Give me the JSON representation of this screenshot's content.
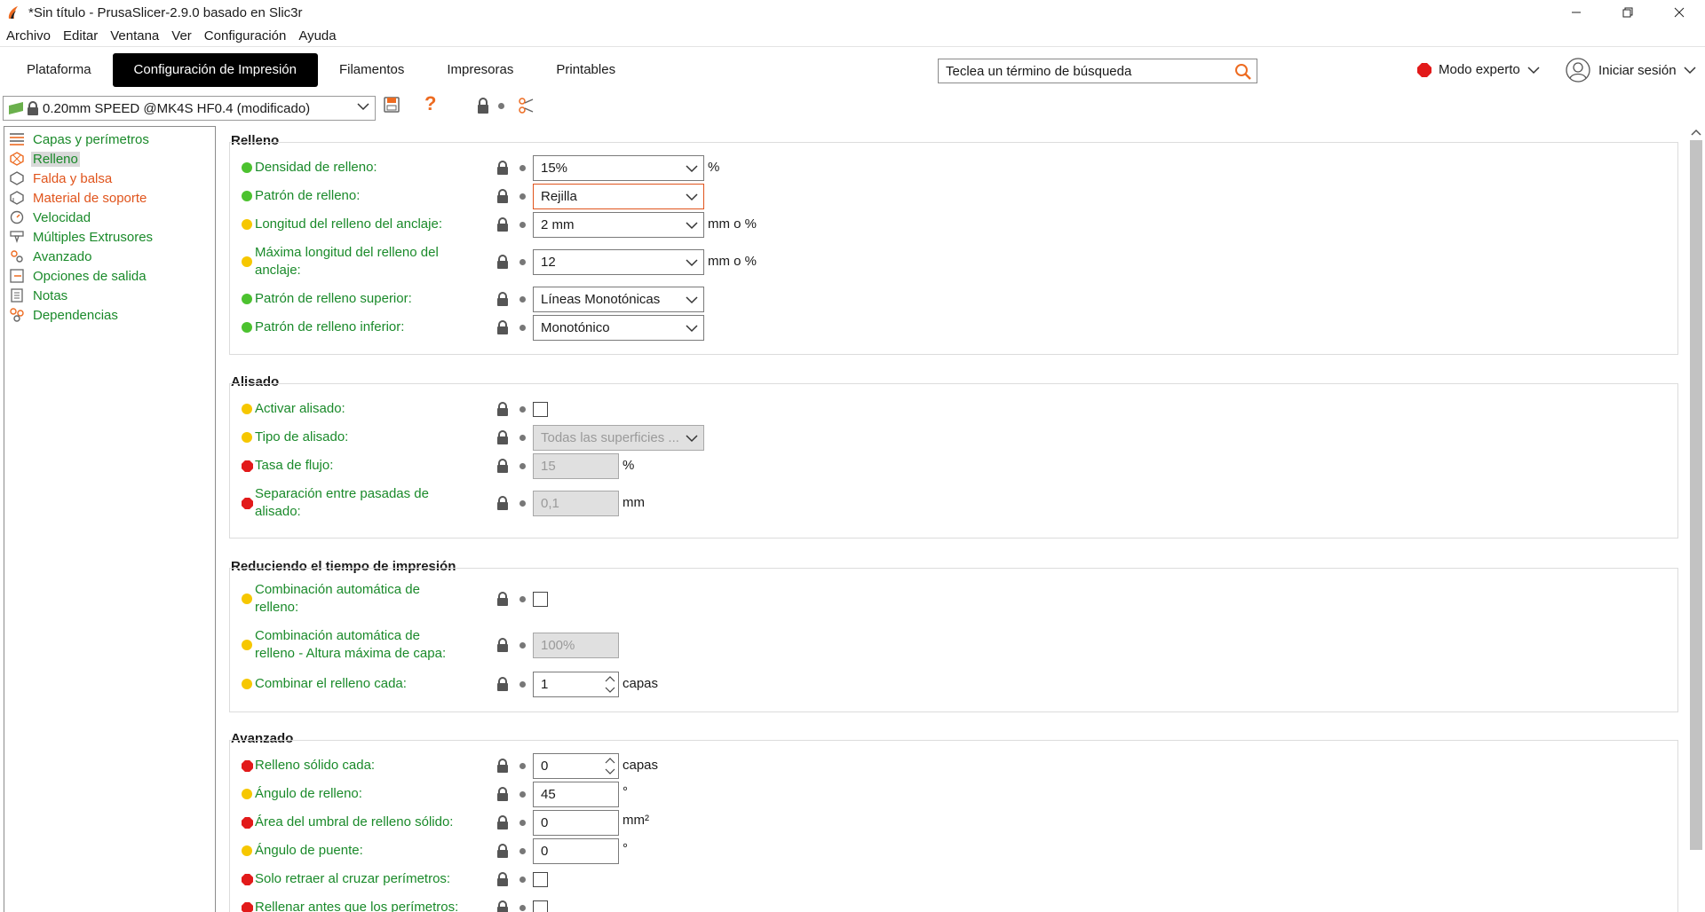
{
  "window": {
    "title": "*Sin título - PrusaSlicer-2.9.0 basado en Slic3r",
    "minimize_icon": "minimize-icon",
    "maximize_icon": "restore-icon",
    "close_icon": "close-icon"
  },
  "menu": [
    "Archivo",
    "Editar",
    "Ventana",
    "Ver",
    "Configuración",
    "Ayuda"
  ],
  "tabs": [
    {
      "label": "Plataforma",
      "active": false
    },
    {
      "label": "Configuración de Impresión",
      "active": true
    },
    {
      "label": "Filamentos",
      "active": false
    },
    {
      "label": "Impresoras",
      "active": false
    },
    {
      "label": "Printables",
      "active": false
    }
  ],
  "search": {
    "placeholder": "Teclea un término de búsqueda"
  },
  "mode": {
    "label": "Modo experto",
    "color": "#e21a1a"
  },
  "login": {
    "label": "Iniciar sesión"
  },
  "preset": {
    "value": "0.20mm SPEED @MK4S HF0.4 (modificado)"
  },
  "help_glyph": "?",
  "nav": [
    {
      "label": "Capas y perímetros",
      "color": "green",
      "icon": "layers-icon",
      "selected": false
    },
    {
      "label": "Relleno",
      "color": "green",
      "icon": "infill-icon",
      "selected": true
    },
    {
      "label": "Falda y balsa",
      "color": "orange",
      "icon": "skirt-icon",
      "selected": false
    },
    {
      "label": "Material de soporte",
      "color": "orange",
      "icon": "support-icon",
      "selected": false
    },
    {
      "label": "Velocidad",
      "color": "green",
      "icon": "speed-icon",
      "selected": false
    },
    {
      "label": "Múltiples Extrusores",
      "color": "green",
      "icon": "extruders-icon",
      "selected": false
    },
    {
      "label": "Avanzado",
      "color": "green",
      "icon": "advanced-icon",
      "selected": false
    },
    {
      "label": "Opciones de salida",
      "color": "green",
      "icon": "output-icon",
      "selected": false
    },
    {
      "label": "Notas",
      "color": "green",
      "icon": "notes-icon",
      "selected": false
    },
    {
      "label": "Dependencias",
      "color": "green",
      "icon": "dependencies-icon",
      "selected": false
    }
  ],
  "groups": {
    "relleno": {
      "title": "Relleno",
      "rows": [
        {
          "label": "Densidad de relleno:",
          "status": "g",
          "value": "15%",
          "unit": "%"
        },
        {
          "label": "Patrón de relleno:",
          "status": "g",
          "value": "Rejilla",
          "unit": ""
        },
        {
          "label": "Longitud del relleno del anclaje:",
          "status": "y",
          "value": "2 mm",
          "unit": "mm o %"
        },
        {
          "label_1": "Máxima longitud del relleno del",
          "label_2": "anclaje:",
          "status": "y",
          "value": "12",
          "unit": "mm o %"
        },
        {
          "label": "Patrón de relleno superior:",
          "status": "g",
          "value": "Líneas Monotónicas",
          "unit": ""
        },
        {
          "label": "Patrón de relleno inferior:",
          "status": "g",
          "value": "Monotónico",
          "unit": ""
        }
      ]
    },
    "alisado": {
      "title": "Alisado",
      "rows": [
        {
          "label": "Activar alisado:",
          "status": "y",
          "checked": false
        },
        {
          "label": "Tipo de alisado:",
          "status": "y",
          "value": "Todas las superficies ...",
          "disabled": true
        },
        {
          "label": "Tasa de flujo:",
          "status": "r",
          "value": "15",
          "unit": "%",
          "disabled": true
        },
        {
          "label_1": "Separación entre pasadas de",
          "label_2": "alisado:",
          "status": "r",
          "value": "0,1",
          "unit": "mm",
          "disabled": true
        }
      ]
    },
    "reduciendo": {
      "title": "Reduciendo el tiempo de impresión",
      "rows": [
        {
          "label_1": "Combinación automática de",
          "label_2": "relleno:",
          "status": "y",
          "checked": false
        },
        {
          "label_1": "Combinación automática de",
          "label_2": "relleno - Altura máxima de capa:",
          "status": "y",
          "value": "100%",
          "disabled": true
        },
        {
          "label": "Combinar el relleno cada:",
          "status": "y",
          "value": "1",
          "unit": "capas"
        }
      ]
    },
    "avanzado": {
      "title": "Avanzado",
      "rows": [
        {
          "label": "Relleno sólido cada:",
          "status": "r",
          "value": "0",
          "unit": "capas"
        },
        {
          "label": "Ángulo de relleno:",
          "status": "y",
          "value": "45",
          "unit": "°"
        },
        {
          "label": "Área del umbral de relleno sólido:",
          "status": "r",
          "value": "0",
          "unit": "mm²"
        },
        {
          "label": "Ángulo de puente:",
          "status": "y",
          "value": "0",
          "unit": "°"
        },
        {
          "label": "Solo retraer al cruzar perímetros:",
          "status": "r",
          "checked": false
        },
        {
          "label": "Rellenar antes que los perímetros:",
          "status": "r",
          "checked": false
        }
      ]
    }
  }
}
